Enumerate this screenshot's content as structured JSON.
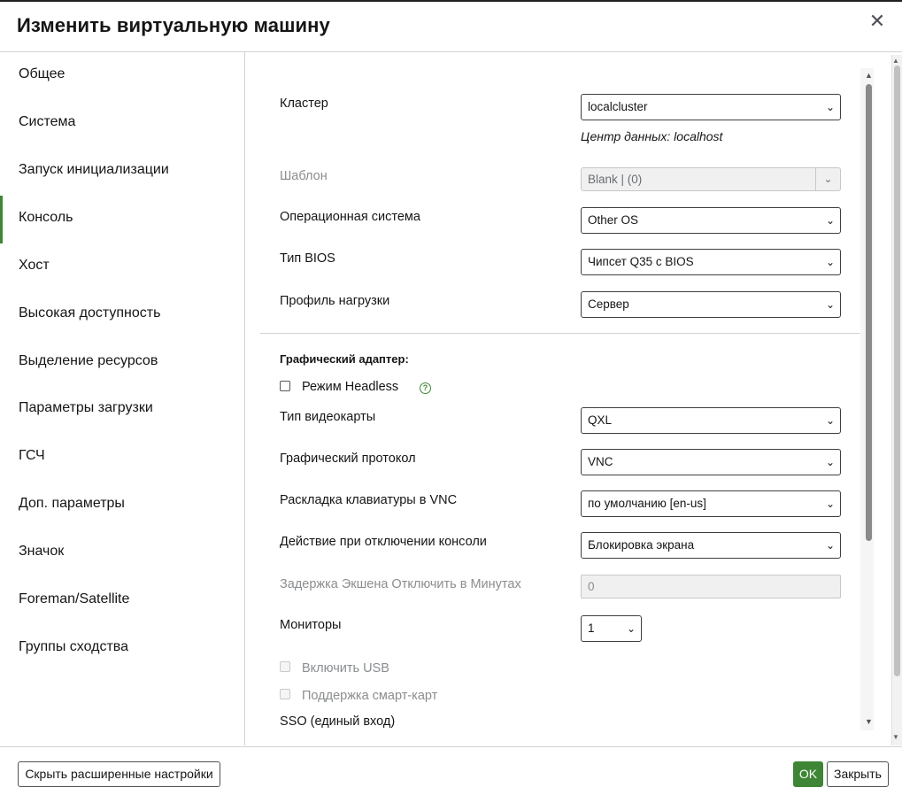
{
  "dialog": {
    "title": "Изменить виртуальную машину",
    "close_glyph": "✕"
  },
  "sidebar": {
    "active": "Консоль",
    "items": [
      {
        "label": "Общее"
      },
      {
        "label": "Система"
      },
      {
        "label": "Запуск инициализации"
      },
      {
        "label": "Консоль"
      },
      {
        "label": "Хост"
      },
      {
        "label": "Высокая доступность"
      },
      {
        "label": "Выделение ресурсов"
      },
      {
        "label": "Параметры загрузки"
      },
      {
        "label": "ГСЧ"
      },
      {
        "label": "Доп. параметры"
      },
      {
        "label": "Значок"
      },
      {
        "label": "Foreman/Satellite"
      },
      {
        "label": "Группы сходства"
      }
    ]
  },
  "form": {
    "cluster": {
      "label": "Кластер",
      "value": "localcluster",
      "hint": "Центр данных: localhost"
    },
    "template": {
      "label": "Шаблон",
      "value": "Blank |  (0)",
      "disabled": true
    },
    "os": {
      "label": "Операционная система",
      "value": "Other OS"
    },
    "bios": {
      "label": "Тип BIOS",
      "value": "Чипсет Q35 с BIOS"
    },
    "profile": {
      "label": "Профиль нагрузки",
      "value": "Сервер"
    },
    "graphics_section": "Графический адаптер:",
    "headless": {
      "label": "Режим Headless",
      "checked": false,
      "help_glyph": "?"
    },
    "video_type": {
      "label": "Тип видеокарты",
      "value": "QXL"
    },
    "graphics_protocol": {
      "label": "Графический протокол",
      "value": "VNC"
    },
    "vnc_keymap": {
      "label": "Раскладка клавиатуры в VNC",
      "value": "по умолчанию [en-us]"
    },
    "disconnect_action": {
      "label": "Действие при отключении консоли",
      "value": "Блокировка экрана"
    },
    "disconnect_delay": {
      "label": "Задержка Экшена Отключить в Минутах",
      "value": "0",
      "disabled": true
    },
    "monitors": {
      "label": "Мониторы",
      "value": "1"
    },
    "usb": {
      "label": "Включить USB",
      "checked": false,
      "disabled": true
    },
    "smartcard": {
      "label": "Поддержка смарт-карт",
      "checked": false,
      "disabled": true
    },
    "sso_label": "SSO (единый вход)"
  },
  "footer": {
    "toggle_advanced": "Скрыть расширенные настройки",
    "ok": "OK",
    "close": "Закрыть"
  },
  "colors": {
    "accent": "#3e8635",
    "border": "#d2d2d2"
  },
  "icons": {
    "chevron": "chevron-down-icon",
    "help": "help-circle-icon",
    "close": "close-icon"
  }
}
